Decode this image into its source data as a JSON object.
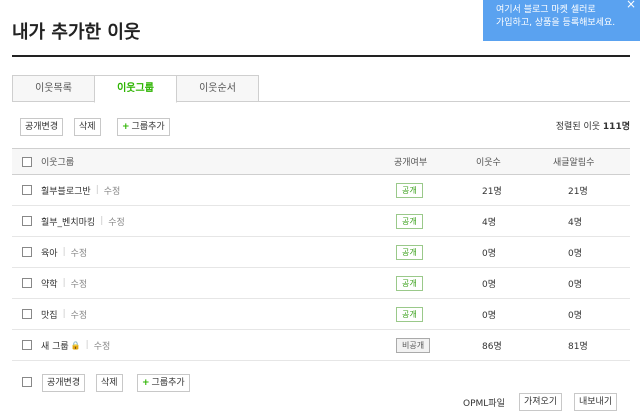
{
  "page": {
    "title": "내가 추가한 이웃"
  },
  "tooltip": {
    "line1": "여기서 블로그 마켓 셀러로",
    "line2": "가입하고, 상품을 등록해보세요.",
    "close_icon": "×"
  },
  "tabs": [
    {
      "label": "이웃목록",
      "active": false
    },
    {
      "label": "이웃그룹",
      "active": true
    },
    {
      "label": "이웃순서",
      "active": false
    }
  ],
  "toolbar": {
    "toggle_public": "공개변경",
    "delete": "삭제",
    "add_group": "그룹추가",
    "plus": "+"
  },
  "sort_info": {
    "prefix": "정렬된 이웃",
    "count": "111명"
  },
  "table": {
    "headers": {
      "name": "이웃그룹",
      "public": "공개여부",
      "count": "이웃수",
      "alert": "새글알림수"
    },
    "edit_label": "수정",
    "rows": [
      {
        "name": "훨부블로그반",
        "public": "공개",
        "count": "21명",
        "alert": "21명",
        "locked": false
      },
      {
        "name": "훨부_벤치마킹",
        "public": "공개",
        "count": "4명",
        "alert": "4명",
        "locked": false
      },
      {
        "name": "육아",
        "public": "공개",
        "count": "0명",
        "alert": "0명",
        "locked": false
      },
      {
        "name": "약학",
        "public": "공개",
        "count": "0명",
        "alert": "0명",
        "locked": false
      },
      {
        "name": "맛집",
        "public": "공개",
        "count": "0명",
        "alert": "0명",
        "locked": false
      },
      {
        "name": "새 그룹",
        "public": "비공개",
        "count": "86명",
        "alert": "81명",
        "locked": true
      }
    ]
  },
  "bottom_toolbar": {
    "toggle_public": "공개변경",
    "delete": "삭제",
    "add_group": "그룹추가",
    "plus": "+"
  },
  "opml": {
    "label": "OPML파일",
    "import": "가져오기",
    "export": "내보내기"
  },
  "colors": {
    "accent": "#2db400",
    "tooltip_bg": "#5aa2f0"
  }
}
